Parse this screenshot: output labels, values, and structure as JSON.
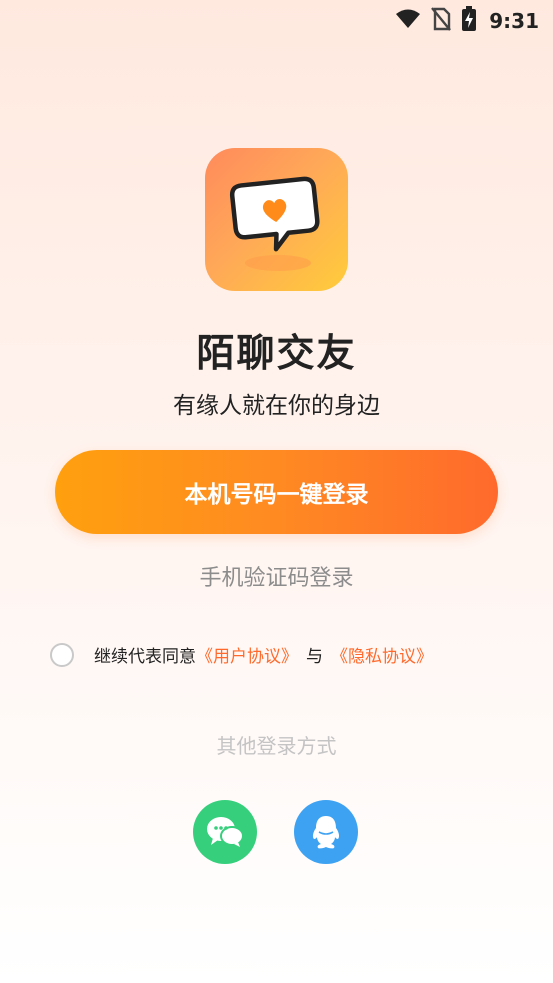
{
  "status_bar": {
    "time": "9:31",
    "icons": [
      "wifi-icon",
      "no-sim-icon",
      "battery-charging-icon"
    ]
  },
  "app": {
    "logo_icon": "chat-bubble-heart-icon",
    "name": "陌聊交友",
    "slogan": "有缘人就在你的身边"
  },
  "login": {
    "one_key_label": "本机号码一键登录",
    "sms_label": "手机验证码登录"
  },
  "agreement": {
    "prefix": "继续代表同意",
    "user_agreement": "《用户协议》",
    "conjunction": "与",
    "privacy_policy": "《隐私协议》"
  },
  "other_login": {
    "title": "其他登录方式",
    "options": [
      "wechat-icon",
      "qq-icon"
    ]
  },
  "colors": {
    "accent_start": "#ffa00e",
    "accent_end": "#ff6a2c",
    "link": "#ff6a2c",
    "wechat": "#36cf7c",
    "qq": "#3ea2f2"
  }
}
